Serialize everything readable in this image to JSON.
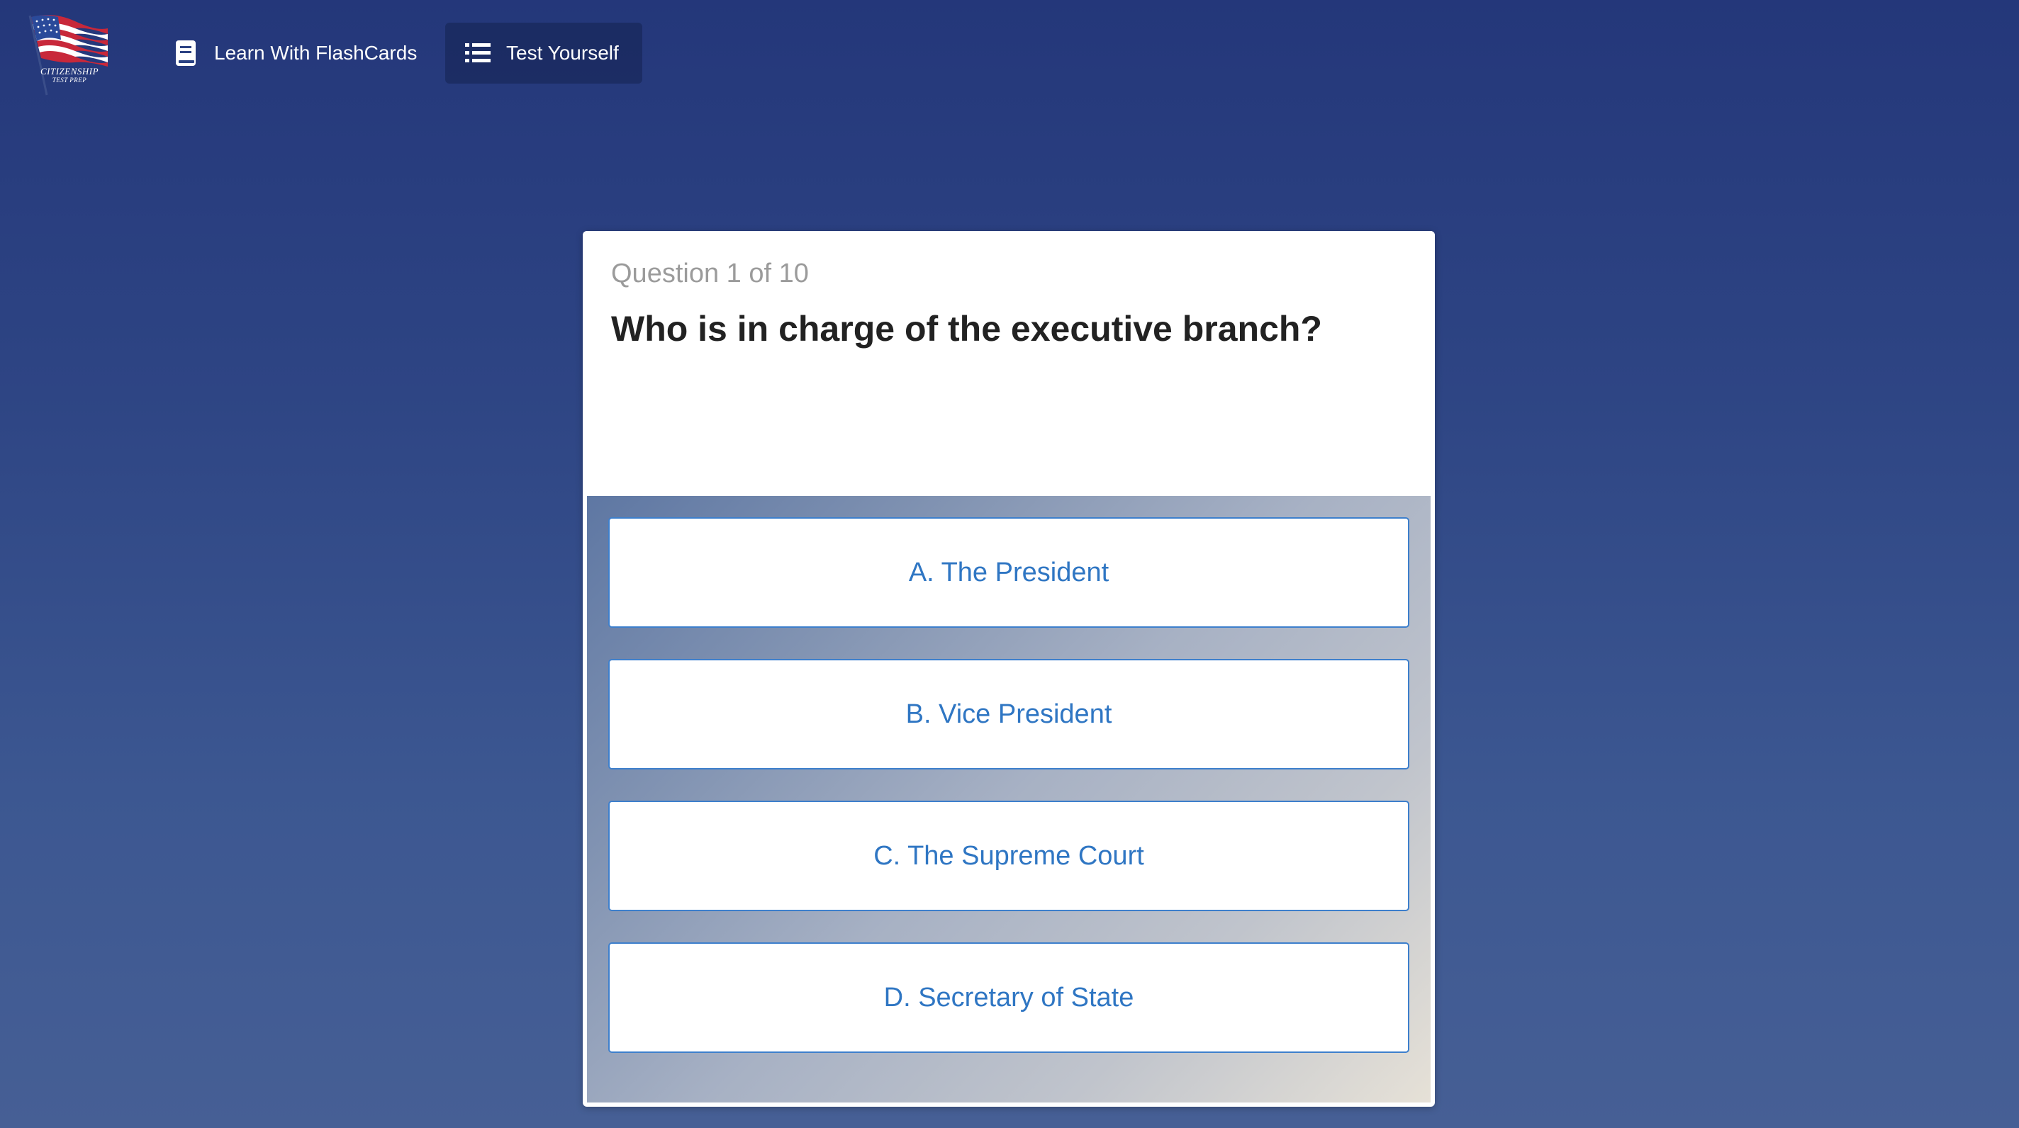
{
  "brand": {
    "logo_line1": "CITIZENSHIP",
    "logo_line2": "TEST PREP"
  },
  "nav": {
    "items": [
      {
        "label": "Learn With FlashCards",
        "icon": "book-icon"
      },
      {
        "label": "Test Yourself",
        "icon": "list-icon",
        "active": true
      }
    ]
  },
  "quiz": {
    "counter": "Question 1 of 10",
    "current": 1,
    "total": 10,
    "question": "Who is in charge of the executive branch?",
    "answers": [
      {
        "label": "A. The President"
      },
      {
        "label": "B. Vice President"
      },
      {
        "label": "C. The Supreme Court"
      },
      {
        "label": "D. Secretary of State"
      }
    ]
  },
  "colors": {
    "background_top": "#24377a",
    "background_bottom": "#465f95",
    "answer_text": "#2f76c3",
    "answer_border": "#3d7fcc",
    "question_text": "#222222",
    "counter_text": "#9b9b9b"
  }
}
